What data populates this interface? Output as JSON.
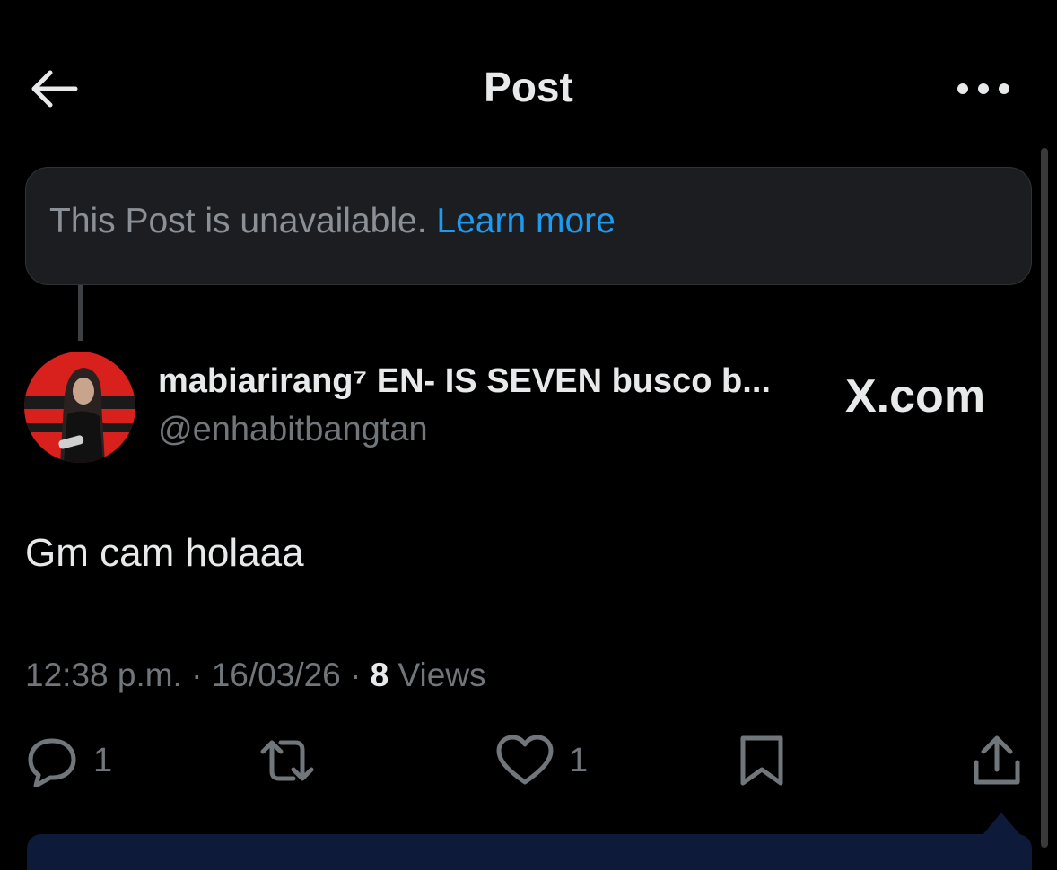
{
  "header": {
    "title": "Post",
    "back_icon": "arrow-left-icon",
    "more_icon": "more-horizontal-icon"
  },
  "notice": {
    "text": "This Post is unavailable. ",
    "link": "Learn more"
  },
  "author": {
    "display_name": "mabiarirang⁷ EN- IS SEVEN busco b...",
    "handle": "@enhabitbangtan"
  },
  "watermark": "X.com",
  "post": {
    "text": "Gm cam holaaa"
  },
  "meta": {
    "time": "12:38 p.m.",
    "separator": " · ",
    "date": "16/03/26",
    "views_count": "8",
    "views_label": " Views"
  },
  "actions": {
    "reply_count": "1",
    "like_count": "1"
  },
  "colors": {
    "background": "#000000",
    "accent": "#1d9bf0",
    "muted": "#71767b",
    "text": "#e7e9ea"
  }
}
